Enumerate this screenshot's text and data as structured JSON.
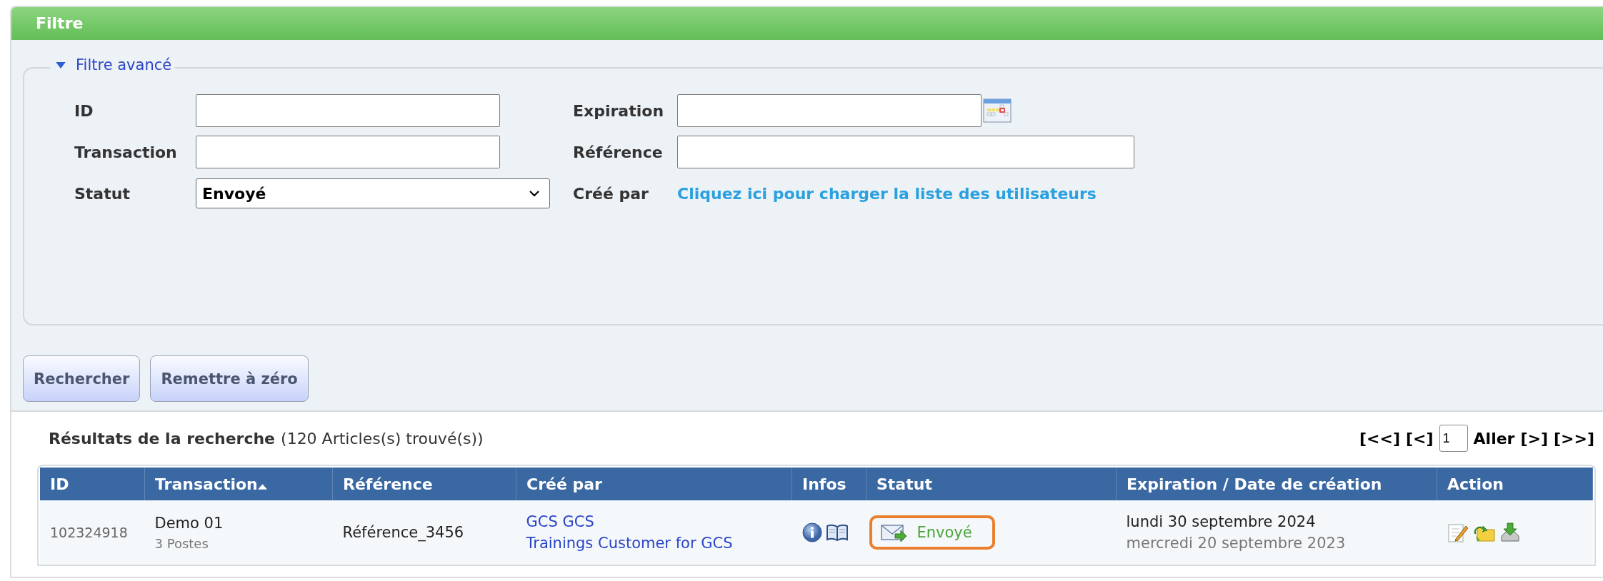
{
  "filter_panel": {
    "title": "Filtre",
    "advanced": {
      "label": "Filtre avancé",
      "expanded": true
    },
    "fields": [
      {
        "label": "ID",
        "kind": "text"
      },
      {
        "label": "Expiration",
        "kind": "date"
      },
      {
        "label": "Transaction",
        "kind": "text"
      },
      {
        "label": "Référence",
        "kind": "text"
      },
      {
        "label": "Statut",
        "kind": "select",
        "value": "Envoyé"
      },
      {
        "label": "Créé par",
        "kind": "link",
        "value": "Cliquez ici pour charger la liste des utilisateurs"
      }
    ],
    "buttons": [
      "Rechercher",
      "Remettre à zéro"
    ]
  },
  "results": {
    "title": "Résultats de la recherche",
    "count": "(120 Articles(s) trouvé(s))",
    "pager": {
      "first": "[<<]",
      "prev": "[<]",
      "page": "1",
      "go": "Aller",
      "next": "[>]",
      "last": "[>>]"
    },
    "table": {
      "columns": [
        {
          "label": "ID",
          "sorted": false
        },
        {
          "label": "Transaction",
          "sorted": true
        },
        {
          "label": "Référence",
          "sorted": false
        },
        {
          "label": "Créé par",
          "sorted": false
        },
        {
          "label": "Infos",
          "sorted": false
        },
        {
          "label": "Statut",
          "sorted": false
        },
        {
          "label": "Expiration / Date de création",
          "sorted": false
        },
        {
          "label": "Action",
          "sorted": false
        }
      ],
      "rows": [
        {
          "id": "102324918",
          "transaction": "Demo 01",
          "items": "3 Postes",
          "reference": "Référence_3456",
          "created_by": [
            "GCS GCS",
            "Trainings Customer for GCS"
          ],
          "status": {
            "label": "Envoyé",
            "kind": "sent",
            "highlighted": true
          },
          "expiration": "lundi 30 septembre 2024",
          "created": "mercredi 20 septembre 2023"
        }
      ]
    }
  }
}
